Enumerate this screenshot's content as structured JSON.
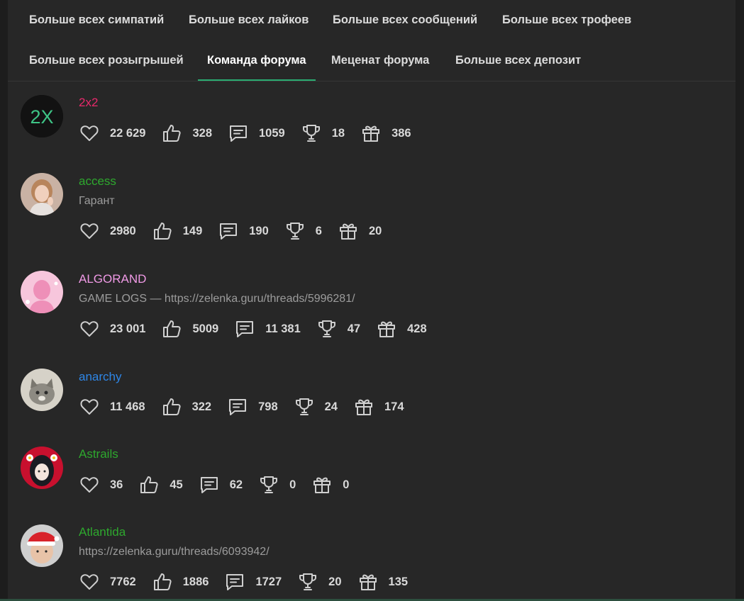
{
  "tabs_row1": [
    {
      "label": "Больше всех симпатий",
      "name": "tab-most-sympathies"
    },
    {
      "label": "Больше всех лайков",
      "name": "tab-most-likes"
    },
    {
      "label": "Больше всех сообщений",
      "name": "tab-most-messages"
    },
    {
      "label": "Больше всех трофеев",
      "name": "tab-most-trophies"
    }
  ],
  "tabs_row2": [
    {
      "label": "Больше всех розыгрышей",
      "name": "tab-most-giveaways"
    },
    {
      "label": "Команда форума",
      "name": "tab-forum-team",
      "active": true
    },
    {
      "label": "Меценат форума",
      "name": "tab-forum-patron"
    },
    {
      "label": "Больше всех депозит",
      "name": "tab-most-deposit"
    }
  ],
  "stat_icons": [
    "heart-icon",
    "thumbs-up-icon",
    "message-icon",
    "trophy-icon",
    "gift-icon"
  ],
  "users": [
    {
      "name": "2x2",
      "color": "#e8296b",
      "title": "",
      "avatar_text": "2X",
      "stats": {
        "sympathies": "22 629",
        "likes": "328",
        "messages": "1059",
        "trophies": "18",
        "gifts": "386"
      }
    },
    {
      "name": "access",
      "color": "#2ea82e",
      "title": "Гарант",
      "stats": {
        "sympathies": "2980",
        "likes": "149",
        "messages": "190",
        "trophies": "6",
        "gifts": "20"
      }
    },
    {
      "name": "ALGORAND",
      "color": "#f09ae6",
      "title": "GAME LOGS — https://zelenka.guru/threads/5996281/",
      "stats": {
        "sympathies": "23 001",
        "likes": "5009",
        "messages": "11 381",
        "trophies": "47",
        "gifts": "428"
      }
    },
    {
      "name": "anarchy",
      "color": "#2e86e6",
      "title": "",
      "stats": {
        "sympathies": "11 468",
        "likes": "322",
        "messages": "798",
        "trophies": "24",
        "gifts": "174"
      }
    },
    {
      "name": "Astrails",
      "color": "#2ea82e",
      "title": "",
      "stats": {
        "sympathies": "36",
        "likes": "45",
        "messages": "62",
        "trophies": "0",
        "gifts": "0"
      }
    },
    {
      "name": "Atlantida",
      "color": "#2ea82e",
      "title": "https://zelenka.guru/threads/6093942/",
      "stats": {
        "sympathies": "7762",
        "likes": "1886",
        "messages": "1727",
        "trophies": "20",
        "gifts": "135"
      }
    }
  ]
}
